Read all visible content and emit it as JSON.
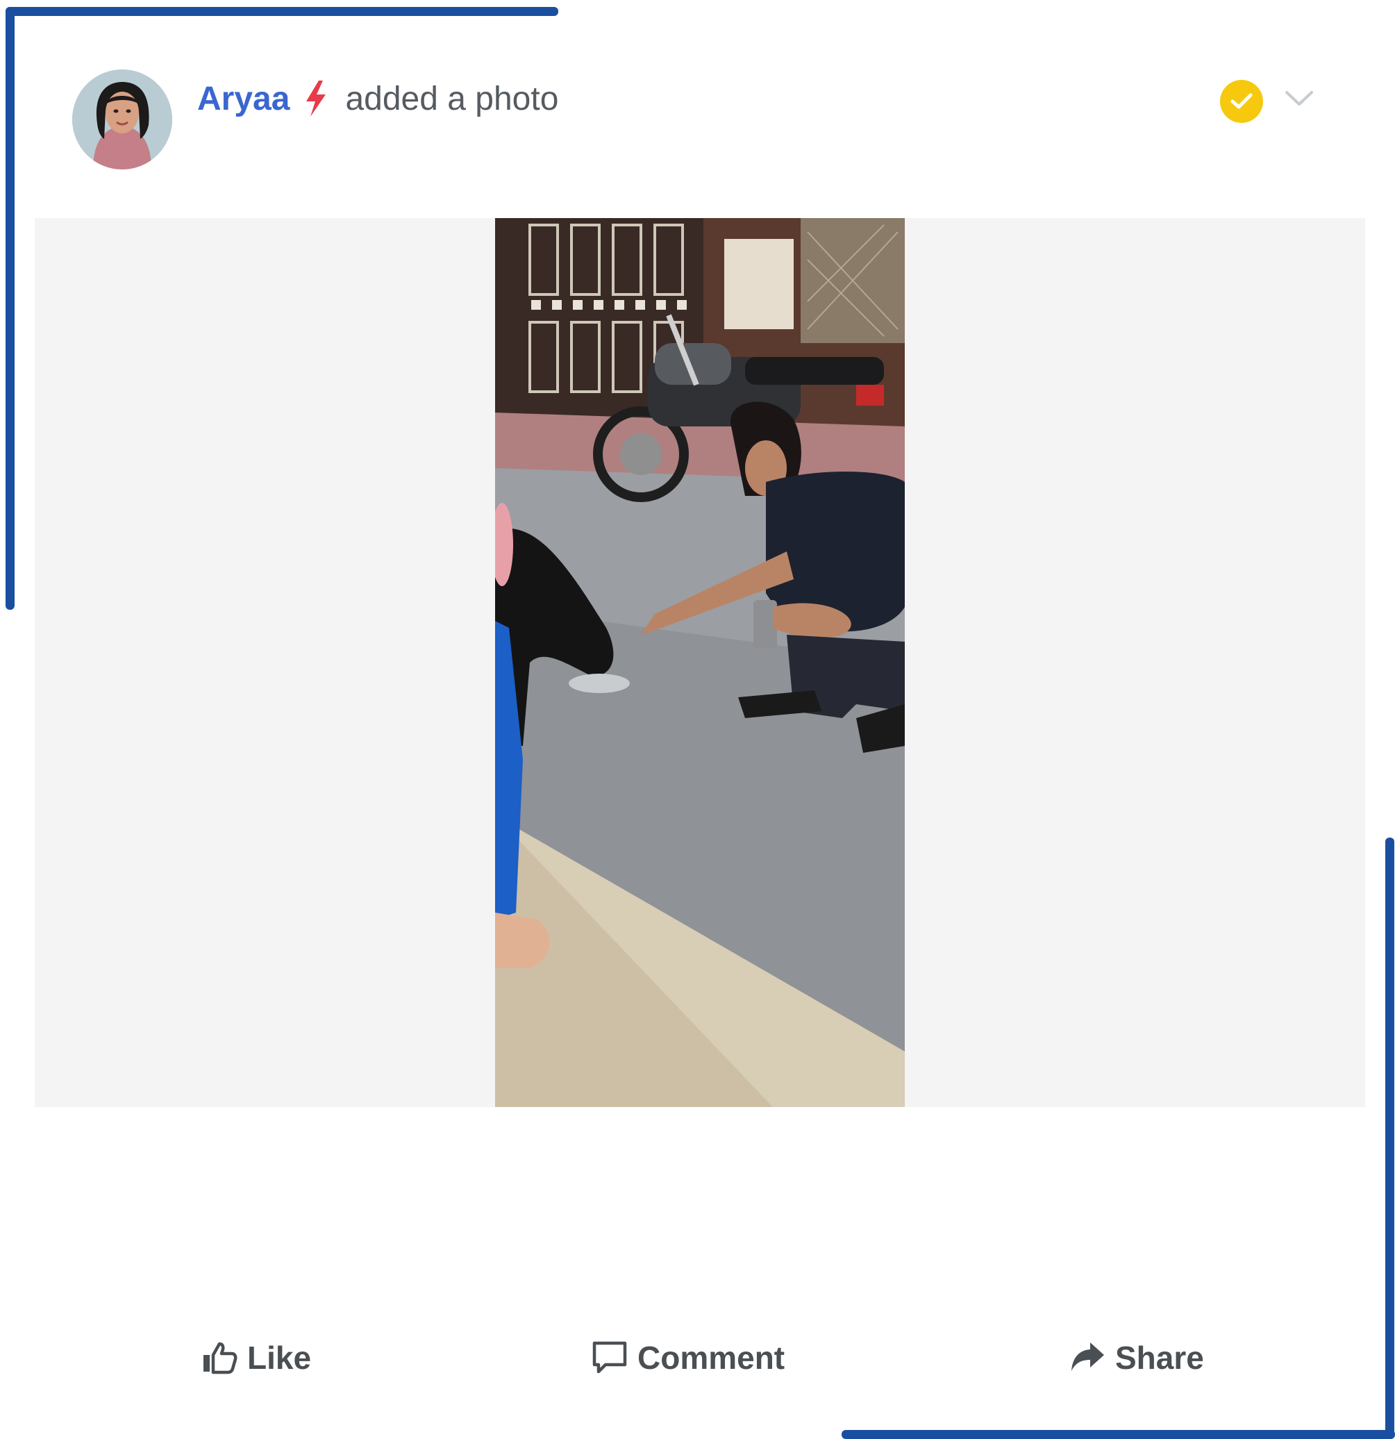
{
  "post": {
    "author_name": "Aryaa",
    "action_text": "added a photo",
    "author_color": "#3a66d0",
    "bolt_color": "#e83a4a",
    "verified_color": "#f6c90e"
  },
  "icons": {
    "avatar": "user-avatar-photo",
    "bolt": "lightning-bolt-icon",
    "verified": "check-circle-icon",
    "menu": "chevron-down-icon",
    "like": "thumbs-up-icon",
    "comment": "comment-bubble-icon",
    "share": "share-arrow-icon"
  },
  "actions": {
    "like_label": "Like",
    "comment_label": "Comment",
    "share_label": "Share"
  },
  "theme": {
    "frame_color": "#1a4fa0",
    "media_background": "#f4f4f4"
  }
}
